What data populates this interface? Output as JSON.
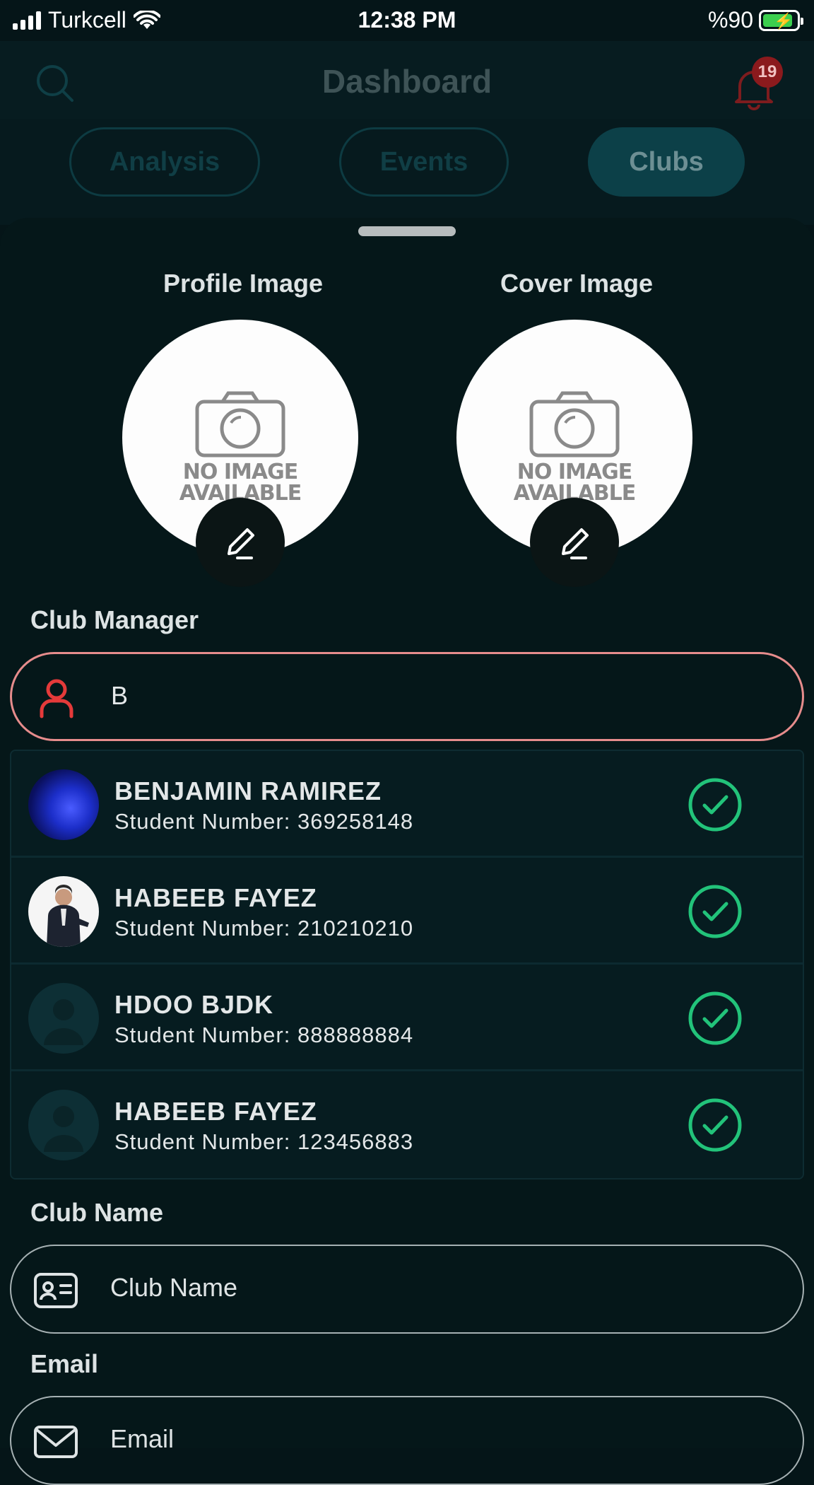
{
  "status_bar": {
    "carrier": "Turkcell",
    "time": "12:38 PM",
    "battery": "%90",
    "battery_level": 0.9
  },
  "header": {
    "title": "Dashboard",
    "notification_count": "19"
  },
  "tabs": [
    {
      "label": "Analysis",
      "active": false
    },
    {
      "label": "Events",
      "active": false
    },
    {
      "label": "Clubs",
      "active": true
    }
  ],
  "images": {
    "profile_label": "Profile Image",
    "cover_label": "Cover Image",
    "placeholder_line1": "NO IMAGE",
    "placeholder_line2": "AVAILABLE"
  },
  "club_manager": {
    "label": "Club Manager",
    "value": "B",
    "results": [
      {
        "name": "BENJAMIN RAMIREZ",
        "student_number": "Student Number: 369258148",
        "avatar": "abstract-blue"
      },
      {
        "name": "HABEEB FAYEZ",
        "student_number": "Student Number: 210210210",
        "avatar": "photo"
      },
      {
        "name": "HDOO BJDK",
        "student_number": "Student Number: 888888884",
        "avatar": "placeholder"
      },
      {
        "name": "HABEEB FAYEZ",
        "student_number": "Student Number: 123456883",
        "avatar": "placeholder"
      }
    ]
  },
  "club_name": {
    "label": "Club Name",
    "placeholder": "Club Name"
  },
  "email": {
    "label": "Email",
    "placeholder": "Email"
  },
  "colors": {
    "accent": "#0c4048",
    "error": "#e68c8c",
    "check": "#22c37a",
    "background": "#051518"
  }
}
